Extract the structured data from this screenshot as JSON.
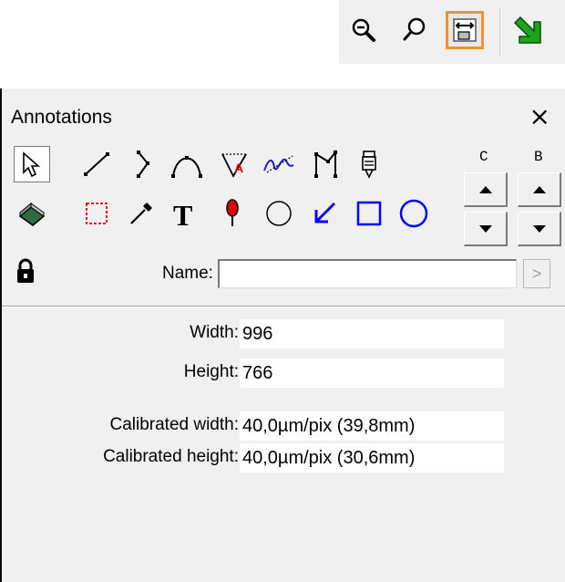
{
  "toolbar": {
    "buttons": [
      {
        "icon": "zoom-in-icon"
      },
      {
        "icon": "zoom-out-icon"
      },
      {
        "icon": "fit-width-icon",
        "active": true
      },
      {
        "icon": "green-arrow-icon"
      }
    ]
  },
  "panel": {
    "title": "Annotations",
    "close_label": "×",
    "tools_row1": [
      "pointer-icon",
      "line-icon",
      "polyline-icon",
      "curve-icon",
      "angle-icon",
      "freehand-icon",
      "open-polygon-icon",
      "marker-icon"
    ],
    "tools_row2": [
      "fill-icon",
      "rectangle-select-icon",
      "pipette-icon",
      "text-icon",
      "pin-icon",
      "circle-outline-icon",
      "arrow-icon",
      "square-icon",
      "circle-icon"
    ],
    "column_c_label": "C",
    "column_b_label": "B",
    "name_label": "Name:",
    "name_value": "",
    "go_label": ">",
    "info": {
      "width_label": "Width:",
      "width_value": "996",
      "height_label": "Height:",
      "height_value": "766",
      "cal_width_label": "Calibrated width:",
      "cal_width_value": "40,0µm/pix (39,8mm)",
      "cal_height_label": "Calibrated height:",
      "cal_height_value": "40,0µm/pix (30,6mm)"
    }
  },
  "colors": {
    "accent_border": "#f0922b",
    "blue_tools": "#0000ff",
    "panel_bg": "#f0f0f0"
  }
}
